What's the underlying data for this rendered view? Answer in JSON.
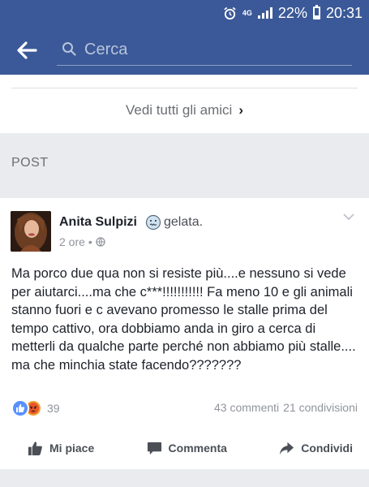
{
  "status_bar": {
    "network": "4G",
    "battery": "22%",
    "time": "20:31",
    "icons": [
      "alarm-icon",
      "signal-icon",
      "battery-icon"
    ]
  },
  "app_bar": {
    "back_icon": "arrow-left-icon",
    "search_icon": "search-icon",
    "search_placeholder": "Cerca"
  },
  "friends_section": {
    "see_all_label": "Vedi tutti gli amici",
    "chevron": "›"
  },
  "posts_section": {
    "header": "POST"
  },
  "post": {
    "author": "Anita Sulpizi",
    "feeling_icon": "cold-face-icon",
    "feeling": "gelata.",
    "time": "2 ore",
    "separator": "•",
    "privacy_icon": "globe-icon",
    "text": "Ma porco due qua non si resiste più....e nessuno si vede per aiutarci....ma che c***!!!!!!!!!!! Fa meno 10 e gli animali stanno fuori e c avevano promesso le stalle prima del tempo cattivo, ora dobbiamo anda in giro a cerca di metterli da qualche parte perché non abbiamo più stalle.... ma che minchia state facendo???????",
    "reaction_icons": [
      "like-reaction-icon",
      "angry-reaction-icon"
    ],
    "reaction_count": "39",
    "comments": "43 commenti",
    "shares": "21 condivisioni"
  },
  "actions": {
    "like": "Mi piace",
    "comment": "Commenta",
    "share": "Condividi"
  },
  "colors": {
    "brand": "#3b5998",
    "like_reaction": "#5890ff",
    "angry_reaction": "#f0a030",
    "background_gray": "#e9ebee"
  }
}
